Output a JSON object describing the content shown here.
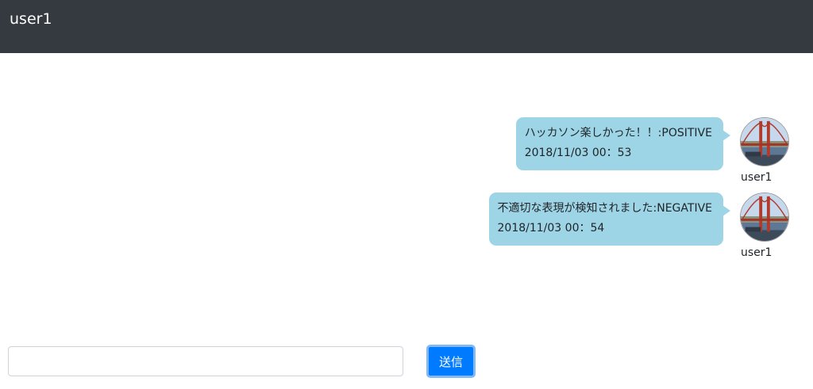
{
  "navbar": {
    "brand": "user1"
  },
  "messages": [
    {
      "text": "ハッカソン楽しかった！！:POSITIVE",
      "timestamp": "2018/11/03 00：53",
      "sender": "user1"
    },
    {
      "text": "不適切な表現が検知されました:NEGATIVE",
      "timestamp": "2018/11/03 00：54",
      "sender": "user1"
    }
  ],
  "composer": {
    "input_value": "",
    "send_label": "送信"
  },
  "colors": {
    "navbar": "#343a40",
    "bubble": "#9dd5e6",
    "send_button": "#007bff"
  },
  "icons": {
    "avatar": "golden-gate-bridge-photo"
  }
}
